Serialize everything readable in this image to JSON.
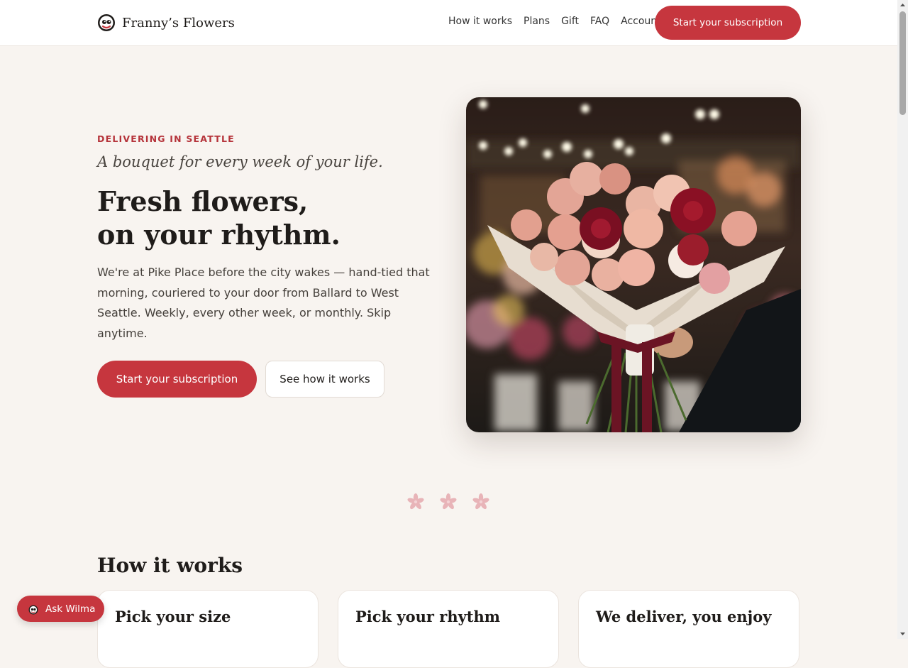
{
  "brand": {
    "name": "Franny’s Flowers",
    "logo_icon": "flower-face-logo-icon"
  },
  "nav": {
    "links": [
      "How it works",
      "Plans",
      "Gift",
      "FAQ",
      "Account"
    ],
    "cta": "Start your subscription"
  },
  "hero": {
    "eyebrow": "DELIVERING IN SEATTLE",
    "tagline": "A bouquet for every week of your life.",
    "headline_line1": "Fresh flowers,",
    "headline_line2": "on your rhythm.",
    "lede": "We're at Pike Place before the city wakes — hand-tied that morning, couriered to your door from Ballard to West Seattle. Weekly, every other week, or monthly. Skip anytime.",
    "primary_button": "Start your subscription",
    "secondary_button": "See how it works"
  },
  "how_it_works": {
    "title": "How it works",
    "cards": [
      {
        "title": "Pick your size"
      },
      {
        "title": "Pick your rhythm"
      },
      {
        "title": "We deliver, you enjoy"
      }
    ]
  },
  "chat": {
    "label": "Ask Wilma",
    "icon": "flower-face-icon"
  },
  "colors": {
    "accent": "#c6363e",
    "background": "#f8f4f0",
    "divider_flower": "#e8b4b8"
  }
}
